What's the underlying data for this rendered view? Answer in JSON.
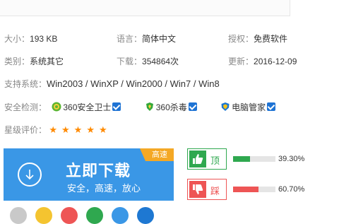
{
  "info": {
    "size_label": "大小：",
    "size_value": "193 KB",
    "lang_label": "语言：",
    "lang_value": "简体中文",
    "license_label": "授权：",
    "license_value": "免费软件",
    "category_label": "类别：",
    "category_value": "系统其它",
    "downloads_label": "下载：",
    "downloads_value": "354864次",
    "update_label": "更新：",
    "update_value": "2016-12-09",
    "system_label": "支持系统：",
    "system_value": "Win2003 / WinXP / Win2000 / Win7 / Win8",
    "security_label": "安全检测：",
    "security_items": [
      "360安全卫士",
      "360杀毒",
      "电脑管家"
    ],
    "rating_label": "星级评价：",
    "rating_stars": 5
  },
  "download": {
    "title": "立即下载",
    "subtitle": "安全，高速，放心",
    "badge": "高速"
  },
  "vote": {
    "up_label": "顶",
    "up_pct": "39.30%",
    "up_value": 39.3,
    "down_label": "踩",
    "down_pct": "60.70%",
    "down_value": 60.7
  },
  "colors": {
    "accent_blue": "#3a97e6",
    "badge_orange": "#f4a825",
    "star_orange": "#ff8a00",
    "up_green": "#2fa84f",
    "down_red": "#ee5555"
  }
}
